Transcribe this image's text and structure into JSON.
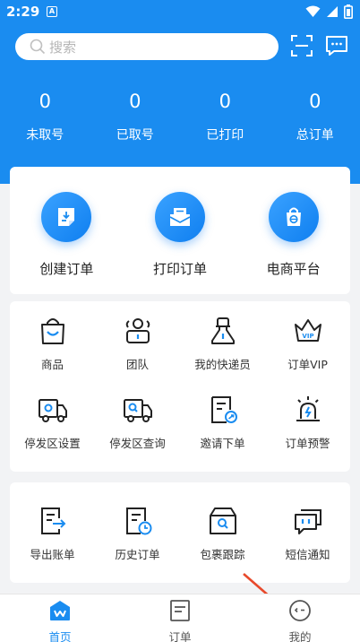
{
  "status_bar": {
    "time": "2:29",
    "notif_letter": "A"
  },
  "search": {
    "placeholder": "搜索"
  },
  "stats": [
    {
      "value": "0",
      "label": "未取号"
    },
    {
      "value": "0",
      "label": "已取号"
    },
    {
      "value": "0",
      "label": "已打印"
    },
    {
      "value": "0",
      "label": "总订单"
    }
  ],
  "main_actions": [
    {
      "label": "创建订单",
      "icon": "create-order-icon"
    },
    {
      "label": "打印订单",
      "icon": "print-order-icon"
    },
    {
      "label": "电商平台",
      "icon": "ecommerce-icon"
    }
  ],
  "features": [
    {
      "label": "商品",
      "icon": "shopping-bag-icon"
    },
    {
      "label": "团队",
      "icon": "team-icon"
    },
    {
      "label": "我的快递员",
      "icon": "courier-icon"
    },
    {
      "label": "订单VIP",
      "icon": "vip-crown-icon"
    },
    {
      "label": "停发区设置",
      "icon": "truck-settings-icon"
    },
    {
      "label": "停发区查询",
      "icon": "truck-search-icon"
    },
    {
      "label": "邀请下单",
      "icon": "invite-icon"
    },
    {
      "label": "订单预警",
      "icon": "alarm-icon"
    }
  ],
  "tools": [
    {
      "label": "导出账单",
      "icon": "export-icon"
    },
    {
      "label": "历史订单",
      "icon": "history-icon"
    },
    {
      "label": "包裹跟踪",
      "icon": "package-track-icon"
    },
    {
      "label": "短信通知",
      "icon": "sms-icon"
    }
  ],
  "bottom_nav": [
    {
      "label": "首页",
      "icon": "home-icon",
      "active": true
    },
    {
      "label": "订单",
      "icon": "order-icon",
      "active": false
    },
    {
      "label": "我的",
      "icon": "profile-icon",
      "active": false
    }
  ],
  "colors": {
    "primary": "#1a8cf0",
    "background": "#f2f3f5",
    "arrow": "#e8492b"
  }
}
